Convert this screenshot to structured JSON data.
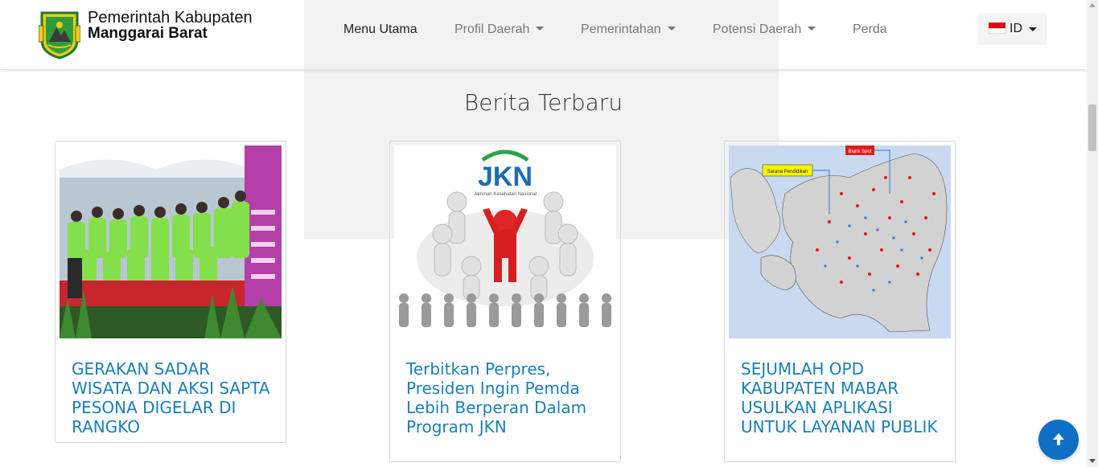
{
  "header": {
    "brand_line1": "Pemerintah Kabupaten",
    "brand_line2": "Manggarai Barat",
    "nav": [
      {
        "label": "Menu Utama",
        "has_dropdown": false,
        "active": true
      },
      {
        "label": "Profil Daerah",
        "has_dropdown": true,
        "active": false
      },
      {
        "label": "Pemerintahan",
        "has_dropdown": true,
        "active": false
      },
      {
        "label": "Potensi Daerah",
        "has_dropdown": true,
        "active": false
      },
      {
        "label": "Perda",
        "has_dropdown": false,
        "active": false
      }
    ],
    "language": {
      "code": "ID",
      "flag": "indonesia-flag-icon"
    }
  },
  "section": {
    "title": "Berita Terbaru"
  },
  "news": [
    {
      "title": "GERAKAN SADAR WISATA DAN AKSI SAPTA PESONA DIGELAR DI RANGKO",
      "image": "group-photo-green-shirts"
    },
    {
      "title": "Terbitkan Perpres, Presiden Ingin Pemda Lebih Berperan Dalam Program JKN",
      "image": "jkn-illustration",
      "image_text": "JKN"
    },
    {
      "title": "SEJUMLAH OPD KABUPATEN MABAR USULKAN APLIKASI UNTUK LAYANAN PUBLIK",
      "image": "map-manggarai-barat",
      "image_labels": [
        "Blank Spot",
        "Sarana Pendidikan"
      ]
    }
  ],
  "colors": {
    "link": "#1a7fb8",
    "back_to_top": "#0f6fc6",
    "flag_red": "#e20613"
  },
  "back_to_top": {
    "icon": "arrow-up-icon"
  }
}
